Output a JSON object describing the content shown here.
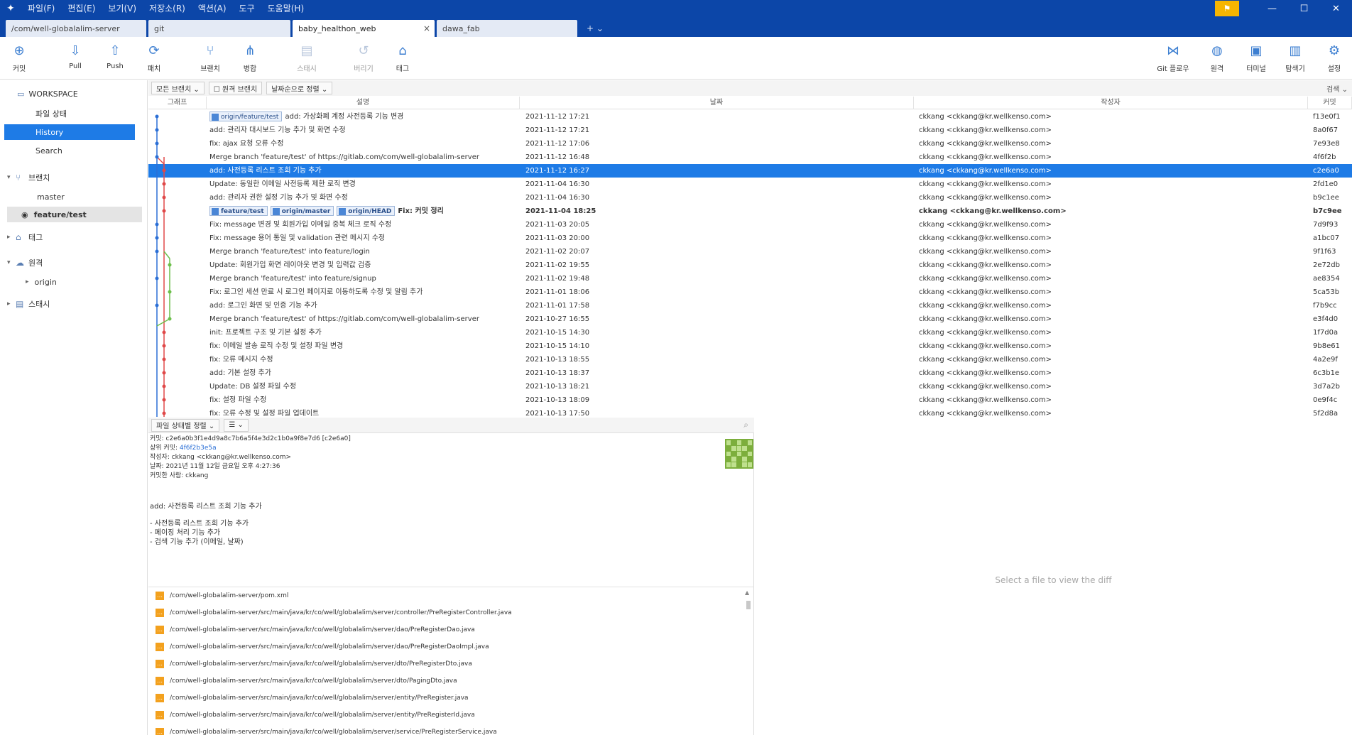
{
  "titlebar": {
    "menu": [
      "파일(F)",
      "편집(E)",
      "보기(V)",
      "저장소(R)",
      "액션(A)",
      "도구",
      "도움말(H)"
    ],
    "min": "—",
    "max": "☐",
    "close": "✕"
  },
  "tabs": [
    {
      "label": "/com/well-globalalim-server"
    },
    {
      "label": "git"
    },
    {
      "label": "baby_healthon_web"
    },
    {
      "label": "dawa_fab"
    }
  ],
  "tab_extra": "+  ⌄",
  "toolbar": {
    "left": [
      {
        "label": "커밋"
      },
      {
        "label": "Pull"
      },
      {
        "label": "Push"
      },
      {
        "label": "패치"
      },
      {
        "label": "브랜치"
      },
      {
        "label": "병합"
      },
      {
        "label": "스태시"
      },
      {
        "label": "버리기"
      },
      {
        "label": "태그"
      }
    ],
    "right": [
      {
        "label": "Git 플로우"
      },
      {
        "label": "원격"
      },
      {
        "label": "터미널"
      },
      {
        "label": "탐색기"
      },
      {
        "label": "설정"
      }
    ]
  },
  "sidebar": {
    "workspace": "WORKSPACE",
    "items": [
      "파일 상태",
      "History",
      "Search"
    ],
    "branches_label": "브랜치",
    "branches": [
      "master",
      "feature/test"
    ],
    "tags_label": "태그",
    "remotes_label": "원격",
    "remote_origin": "origin",
    "stash_label": "스태시"
  },
  "history": {
    "filters": [
      "모든 브랜치 ⌄",
      "☐ 원격 브랜치",
      "날짜순으로 정렬 ⌄"
    ],
    "jump": "검색 ⌄",
    "columns": [
      "그래프",
      "설명",
      "날짜",
      "작성자",
      "커밋"
    ],
    "rows": [
      {
        "tags": [
          "origin/feature/test"
        ],
        "desc": "add: 가상화폐 계정 사전등록 기능 변경",
        "date": "2021-11-12 17:21",
        "author": "ckkang <ckkang@kr.wellkenso.com>",
        "hash": "f13e0f1"
      },
      {
        "desc": "add: 관리자 대시보드 기능 추가 및 화면 수정",
        "date": "2021-11-12 17:21",
        "author": "ckkang <ckkang@kr.wellkenso.com>",
        "hash": "8a0f67"
      },
      {
        "desc": "fix: ajax 요청 오류 수정",
        "date": "2021-11-12 17:06",
        "author": "ckkang <ckkang@kr.wellkenso.com>",
        "hash": "7e93e8"
      },
      {
        "desc": "Merge branch 'feature/test' of https://gitlab.com/com/well-globalalim-server",
        "date": "2021-11-12 16:48",
        "author": "ckkang <ckkang@kr.wellkenso.com>",
        "hash": "4f6f2b"
      },
      {
        "desc": "add: 사전등록 리스트 조회 기능 추가",
        "date": "2021-11-12 16:27",
        "author": "ckkang <ckkang@kr.wellkenso.com>",
        "hash": "c2e6a0",
        "selected": true
      },
      {
        "desc": "Update: 동일한 이메일 사전등록 제한 로직 변경",
        "date": "2021-11-04 16:30",
        "author": "ckkang <ckkang@kr.wellkenso.com>",
        "hash": "2fd1e0"
      },
      {
        "desc": "add: 관리자 권한 설정 기능 추가 및 화면 수정",
        "date": "2021-11-04 16:30",
        "author": "ckkang <ckkang@kr.wellkenso.com>",
        "hash": "b9c1ee"
      },
      {
        "tags": [
          "feature/test",
          "origin/master",
          "origin/HEAD"
        ],
        "desc": "Fix: 커밋 정리",
        "date": "2021-11-04 18:25",
        "author": "ckkang <ckkang@kr.wellkenso.com>",
        "hash": "b7c9ee",
        "bold": true
      },
      {
        "desc": "Fix: message 변경 및 회원가입 이메일 중복 체크 로직 수정",
        "date": "2021-11-03 20:05",
        "author": "ckkang <ckkang@kr.wellkenso.com>",
        "hash": "7d9f93"
      },
      {
        "desc": "Fix: message 용어 통일 및 validation 관련 메시지 수정",
        "date": "2021-11-03 20:00",
        "author": "ckkang <ckkang@kr.wellkenso.com>",
        "hash": "a1bc07"
      },
      {
        "desc": "Merge branch 'feature/test' into feature/login",
        "date": "2021-11-02 20:07",
        "author": "ckkang <ckkang@kr.wellkenso.com>",
        "hash": "9f1f63"
      },
      {
        "desc": "Update: 회원가입 화면 레이아웃 변경 및 입력값 검증",
        "date": "2021-11-02 19:55",
        "author": "ckkang <ckkang@kr.wellkenso.com>",
        "hash": "2e72db"
      },
      {
        "desc": "Merge branch 'feature/test' into feature/signup",
        "date": "2021-11-02 19:48",
        "author": "ckkang <ckkang@kr.wellkenso.com>",
        "hash": "ae8354"
      },
      {
        "desc": "Fix: 로그인 세션 만료 시 로그인 페이지로 이동하도록 수정 및 알림 추가",
        "date": "2021-11-01 18:06",
        "author": "ckkang <ckkang@kr.wellkenso.com>",
        "hash": "5ca53b"
      },
      {
        "desc": "add: 로그인 화면 및 인증 기능 추가",
        "date": "2021-11-01 17:58",
        "author": "ckkang <ckkang@kr.wellkenso.com>",
        "hash": "f7b9cc"
      },
      {
        "desc": "Merge branch 'feature/test' of https://gitlab.com/com/well-globalalim-server",
        "date": "2021-10-27 16:55",
        "author": "ckkang <ckkang@kr.wellkenso.com>",
        "hash": "e3f4d0"
      },
      {
        "desc": "init: 프로젝트 구조 및 기본 설정 추가",
        "date": "2021-10-15 14:30",
        "author": "ckkang <ckkang@kr.wellkenso.com>",
        "hash": "1f7d0a"
      },
      {
        "desc": "fix: 이메일 발송 로직 수정 및 설정 파일 변경",
        "date": "2021-10-15 14:10",
        "author": "ckkang <ckkang@kr.wellkenso.com>",
        "hash": "9b8e61"
      },
      {
        "desc": "fix: 오류 메시지 수정",
        "date": "2021-10-13 18:55",
        "author": "ckkang <ckkang@kr.wellkenso.com>",
        "hash": "4a2e9f"
      },
      {
        "desc": "add: 기본 설정 추가",
        "date": "2021-10-13 18:37",
        "author": "ckkang <ckkang@kr.wellkenso.com>",
        "hash": "6c3b1e"
      },
      {
        "desc": "Update: DB 설정 파일 수정",
        "date": "2021-10-13 18:21",
        "author": "ckkang <ckkang@kr.wellkenso.com>",
        "hash": "3d7a2b"
      },
      {
        "desc": "fix: 설정 파일 수정",
        "date": "2021-10-13 18:09",
        "author": "ckkang <ckkang@kr.wellkenso.com>",
        "hash": "0e9f4c"
      },
      {
        "desc": "fix: 오류 수정 및 설정 파일 업데이트",
        "date": "2021-10-13 17:50",
        "author": "ckkang <ckkang@kr.wellkenso.com>",
        "hash": "5f2d8a"
      }
    ]
  },
  "details": {
    "view_mode": "파일 상태별 정렬 ⌄",
    "view_toggle": "☰ ⌄",
    "search_icon": "⌕",
    "meta": [
      "커밋: c2e6a0b3f1e4d9a8c7b6a5f4e3d2c1b0a9f8e7d6 [c2e6a0]",
      "상위 커밋:",
      "작성자: ckkang <ckkang@kr.wellkenso.com>",
      "날짜: 2021년 11월 12일 금요일 오후 4:27:36",
      "커밋한 사람: ckkang"
    ],
    "parent_link": "4f6f2b3e5a",
    "message": [
      "add: 사전등록 리스트 조회 기능 추가",
      "",
      "- 사전등록 리스트 조회 기능 추가",
      "- 페이징 처리 기능 추가",
      "- 검색 기능 추가 (이메일, 날짜)"
    ],
    "files": [
      "/com/well-globalalim-server/pom.xml",
      "/com/well-globalalim-server/src/main/java/kr/co/well/globalalim/server/controller/PreRegisterController.java",
      "/com/well-globalalim-server/src/main/java/kr/co/well/globalalim/server/dao/PreRegisterDao.java",
      "/com/well-globalalim-server/src/main/java/kr/co/well/globalalim/server/dao/PreRegisterDaoImpl.java",
      "/com/well-globalalim-server/src/main/java/kr/co/well/globalalim/server/dto/PreRegisterDto.java",
      "/com/well-globalalim-server/src/main/java/kr/co/well/globalalim/server/dto/PagingDto.java",
      "/com/well-globalalim-server/src/main/java/kr/co/well/globalalim/server/entity/PreRegister.java",
      "/com/well-globalalim-server/src/main/java/kr/co/well/globalalim/server/entity/PreRegisterId.java",
      "/com/well-globalalim-server/src/main/java/kr/co/well/globalalim/server/service/PreRegisterService.java"
    ]
  },
  "diff": {
    "placeholder": "Select a file to view the diff"
  },
  "colors": {
    "accent": "#1e7be6",
    "titlebar": "#0c46a8",
    "graph_blue": "#2b6fd6",
    "graph_red": "#e04848",
    "graph_green": "#6cbf4a"
  }
}
